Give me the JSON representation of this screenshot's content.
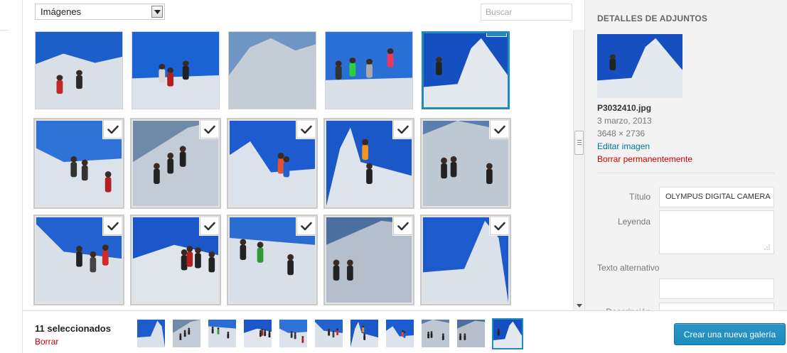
{
  "toolbar": {
    "filter_selected": "Imágenes",
    "search_placeholder": "Buscar"
  },
  "sidebar": {
    "title": "DETALLES DE ADJUNTOS",
    "filename": "P3032410.jpg",
    "date": "3 marzo, 2013",
    "dimensions": "3648 × 2736",
    "edit_label": "Editar imagen",
    "delete_label": "Borrar permanentemente",
    "fields": {
      "title_label": "Título",
      "title_value": "OLYMPUS DIGITAL CAMERA",
      "caption_label": "Leyenda",
      "caption_value": "",
      "alt_label": "Texto alternativo",
      "alt_value": "",
      "description_label": "Descripción"
    }
  },
  "footer": {
    "selected_count": "11 seleccionados",
    "clear_label": "Borrar",
    "create_button": "Crear una nueva galería"
  },
  "colors": {
    "accent": "#1e8cbe",
    "danger": "#cc0000",
    "link": "#0074a2"
  },
  "grid": {
    "rows": [
      [
        {
          "id": 1,
          "selected": false,
          "current": false,
          "scene": "summit-bags"
        },
        {
          "id": 2,
          "selected": false,
          "current": false,
          "scene": "two-hikers"
        },
        {
          "id": 3,
          "selected": false,
          "current": false,
          "scene": "rock-peak"
        },
        {
          "id": 4,
          "selected": false,
          "current": false,
          "scene": "group-bright"
        },
        {
          "id": 5,
          "selected": true,
          "current": true,
          "scene": "ridge-climber"
        }
      ],
      [
        {
          "id": 6,
          "selected": true,
          "current": false,
          "scene": "slope-group"
        },
        {
          "id": 7,
          "selected": true,
          "current": false,
          "scene": "ridge-line"
        },
        {
          "id": 8,
          "selected": true,
          "current": false,
          "scene": "colorful-climber"
        },
        {
          "id": 9,
          "selected": true,
          "current": false,
          "scene": "helmet-selfie"
        },
        {
          "id": 10,
          "selected": true,
          "current": false,
          "scene": "snow-field"
        }
      ],
      [
        {
          "id": 11,
          "selected": true,
          "current": false,
          "scene": "red-jacket"
        },
        {
          "id": 12,
          "selected": true,
          "current": false,
          "scene": "trail-group"
        },
        {
          "id": 13,
          "selected": true,
          "current": false,
          "scene": "valley-group"
        },
        {
          "id": 14,
          "selected": true,
          "current": false,
          "scene": "dark-ridge"
        },
        {
          "id": 15,
          "selected": true,
          "current": false,
          "scene": "tall-peak"
        }
      ]
    ]
  },
  "strip_items": [
    {
      "scene": "tall-peak",
      "current": false
    },
    {
      "scene": "ridge-line",
      "current": false
    },
    {
      "scene": "valley-group",
      "current": false
    },
    {
      "scene": "trail-group",
      "current": false
    },
    {
      "scene": "slope-group",
      "current": false
    },
    {
      "scene": "red-jacket",
      "current": false
    },
    {
      "scene": "helmet-selfie",
      "current": false
    },
    {
      "scene": "colorful-climber",
      "current": false
    },
    {
      "scene": "snow-field",
      "current": false
    },
    {
      "scene": "dark-ridge",
      "current": false
    },
    {
      "scene": "ridge-climber",
      "current": true
    }
  ]
}
